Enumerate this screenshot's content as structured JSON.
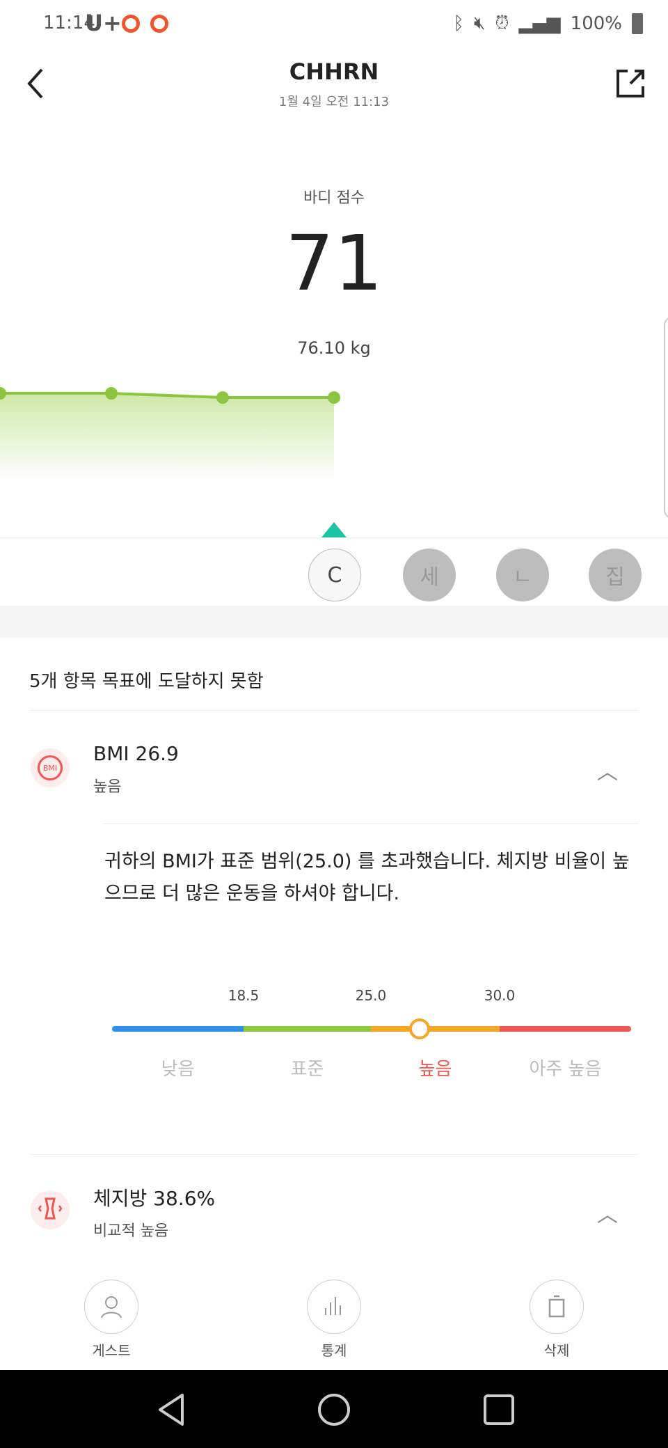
{
  "status_bar": {
    "time": "11:14",
    "carrier": "U+",
    "battery": "100%"
  },
  "header": {
    "title": "CHHRN",
    "subtitle": "1월 4일 오전 11:13"
  },
  "score": {
    "label": "바디 점수",
    "value": "71",
    "weight": "76.10 kg"
  },
  "trend": {
    "points": [
      72,
      72,
      71,
      71
    ],
    "line_color": "#8cc63f"
  },
  "users": [
    {
      "label": "C",
      "selected": true
    },
    {
      "label": "세",
      "selected": false
    },
    {
      "label": "ㄴ",
      "selected": false
    },
    {
      "label": "집",
      "selected": false
    }
  ],
  "summary": "5개 항목 목표에 도달하지 못함",
  "bmi": {
    "title": "BMI  26.9",
    "status": "높음",
    "description": "귀하의 BMI가 표준 범위(25.0) 를 초과했습니다. 체지방 비율이 높으므로 더 많은 운동을 하셔야 합니다.",
    "value": 26.9,
    "ticks": [
      "18.5",
      "25.0",
      "30.0"
    ],
    "categories": [
      "낮음",
      "표준",
      "높음",
      "아주 높음"
    ],
    "colors": [
      "#2f8fe8",
      "#8cc63f",
      "#f5a623",
      "#f0554f"
    ]
  },
  "body_fat": {
    "title": "체지방  38.6%",
    "status": "비교적 높음"
  },
  "actions": [
    {
      "label": "게스트",
      "icon": "person-icon"
    },
    {
      "label": "통계",
      "icon": "bar-chart-icon"
    },
    {
      "label": "삭제",
      "icon": "trash-icon"
    }
  ]
}
